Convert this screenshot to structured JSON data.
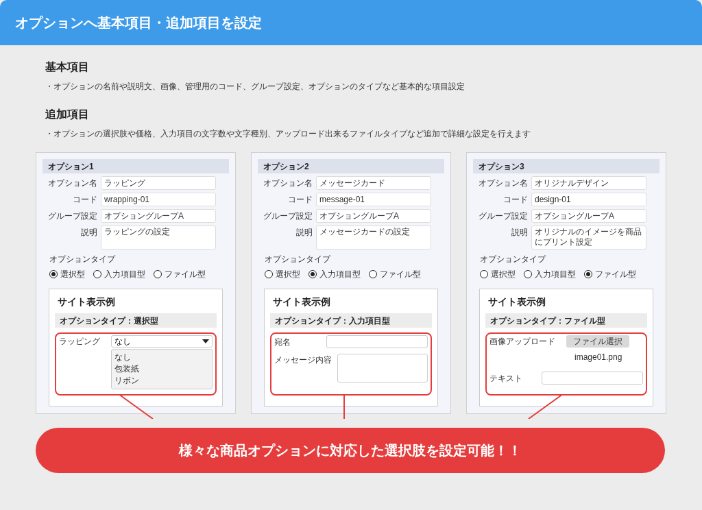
{
  "header": {
    "title": "オプションへ基本項目・追加項目を設定"
  },
  "sections": [
    {
      "heading": "基本項目",
      "text": "・オプションの名前や説明文、画像、管理用のコード、グループ設定、オプションのタイプなど基本的な項目設定"
    },
    {
      "heading": "追加項目",
      "text": "・オプションの選択肢や価格、入力項目の文字数や文字種別、アップロード出来るファイルタイプなど追加で詳細な設定を行えます"
    }
  ],
  "options": [
    {
      "title": "オプション1",
      "fields": [
        {
          "label": "オプション名",
          "value": "ラッピング"
        },
        {
          "label": "コード",
          "value": "wrapping-01"
        },
        {
          "label": "グループ設定",
          "value": "オプショングループA"
        },
        {
          "label": "説明",
          "value": "ラッピングの設定",
          "kind": "area"
        }
      ],
      "type_label": "オプションタイプ",
      "types": [
        {
          "label": "選択型",
          "selected": true
        },
        {
          "label": "入力項目型",
          "selected": false
        },
        {
          "label": "ファイル型",
          "selected": false
        }
      ],
      "preview": {
        "title": "サイト表示例",
        "subtitle": "オプションタイプ：選択型",
        "rows": [
          {
            "kind": "select",
            "label": "ラッピング",
            "value": "なし",
            "choices": [
              "なし",
              "包装紙",
              "リボン"
            ]
          }
        ]
      }
    },
    {
      "title": "オプション2",
      "fields": [
        {
          "label": "オプション名",
          "value": "メッセージカード"
        },
        {
          "label": "コード",
          "value": "message-01"
        },
        {
          "label": "グループ設定",
          "value": "オプショングループA"
        },
        {
          "label": "説明",
          "value": "メッセージカードの設定",
          "kind": "area"
        }
      ],
      "type_label": "オプションタイプ",
      "types": [
        {
          "label": "選択型",
          "selected": false
        },
        {
          "label": "入力項目型",
          "selected": true
        },
        {
          "label": "ファイル型",
          "selected": false
        }
      ],
      "preview": {
        "title": "サイト表示例",
        "subtitle": "オプションタイプ：入力項目型",
        "rows": [
          {
            "kind": "input",
            "label": "宛名"
          },
          {
            "kind": "textarea",
            "label": "メッセージ内容"
          }
        ]
      }
    },
    {
      "title": "オプション3",
      "fields": [
        {
          "label": "オプション名",
          "value": "オリジナルデザイン"
        },
        {
          "label": "コード",
          "value": "design-01"
        },
        {
          "label": "グループ設定",
          "value": "オプショングループA"
        },
        {
          "label": "説明",
          "value": "オリジナルのイメージを商品にプリント設定",
          "kind": "area"
        }
      ],
      "type_label": "オプションタイプ",
      "types": [
        {
          "label": "選択型",
          "selected": false
        },
        {
          "label": "入力項目型",
          "selected": false
        },
        {
          "label": "ファイル型",
          "selected": true
        }
      ],
      "preview": {
        "title": "サイト表示例",
        "subtitle": "オプションタイプ：ファイル型",
        "rows": [
          {
            "kind": "file",
            "label": "画像アップロード",
            "button": "ファイル選択",
            "filename": "image01.png"
          },
          {
            "kind": "input",
            "label": "テキスト"
          }
        ]
      }
    }
  ],
  "callout": {
    "text": "様々な商品オプションに対応した選択肢を設定可能！！"
  }
}
